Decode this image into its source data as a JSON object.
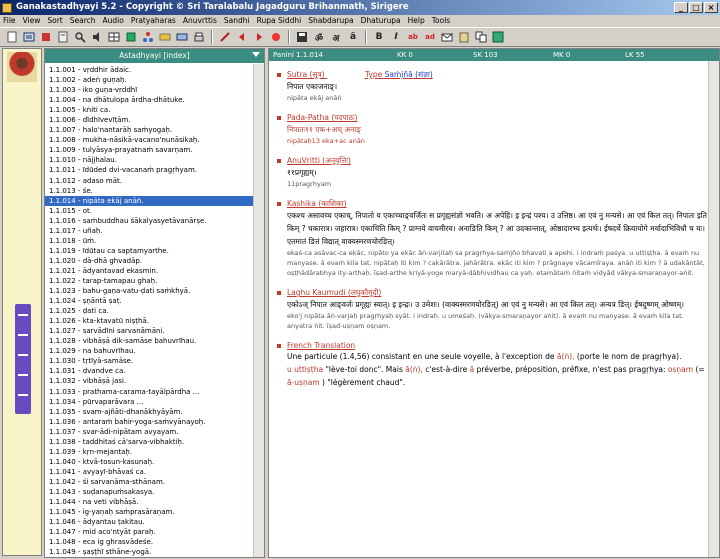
{
  "window": {
    "title": "Ganakastadhyayi 5.2 - Copyright © Sri Taralabalu Jagadguru Brihanmath, Sirigere",
    "buttons": [
      "_",
      "□",
      "×"
    ]
  },
  "menu": [
    "File",
    "View",
    "Sort",
    "Search",
    "Audio",
    "Pratyaharas",
    "Anuvrttis",
    "Sandhi",
    "Rupa Siddhi",
    "Shabdarupa",
    "Dhaturupa",
    "Help",
    "Tools"
  ],
  "toolbar": {
    "text_buttons": [
      "ॐ",
      "अ",
      "ä",
      "B",
      "I",
      "ab",
      "ad"
    ]
  },
  "vertical_title": "अष्टाध्यायी",
  "index": {
    "header": "Astadhyayi [index]",
    "items": [
      {
        "id": "1.1.001",
        "text": "vṛddhir ādaic."
      },
      {
        "id": "1.1.002",
        "text": "adeṅ guṇaḥ."
      },
      {
        "id": "1.1.003",
        "text": "iko guṇa-vṛddhī"
      },
      {
        "id": "1.1.004",
        "text": "na dhātulopa ārdha-dhātuke."
      },
      {
        "id": "1.1.005",
        "text": "kṅiti ca."
      },
      {
        "id": "1.1.006",
        "text": "dīdhīvevīṭām."
      },
      {
        "id": "1.1.007",
        "text": "halo'nantarāḥ saṁyogaḥ."
      },
      {
        "id": "1.1.008",
        "text": "mukha-nāsikā-vacano'nunāsikaḥ."
      },
      {
        "id": "1.1.009",
        "text": "tulyāsya-prayatnaṁ savarṇam."
      },
      {
        "id": "1.1.010",
        "text": "nājjhalau."
      },
      {
        "id": "1.1.011",
        "text": "īdūded dvi-vacanaṁ pragṛhyam."
      },
      {
        "id": "1.1.012",
        "text": "adaso māt."
      },
      {
        "id": "1.1.013",
        "text": "śe."
      },
      {
        "id": "1.1.014",
        "text": "nipāta ekāj anāṅ."
      },
      {
        "id": "1.1.015",
        "text": "ot."
      },
      {
        "id": "1.1.016",
        "text": "saṁbuddhau śākalyasyetāvanārṣe."
      },
      {
        "id": "1.1.017",
        "text": "uñaḥ."
      },
      {
        "id": "1.1.018",
        "text": "ūṁ."
      },
      {
        "id": "1.1.019",
        "text": "īdūtau ca saptamyarthe."
      },
      {
        "id": "1.1.020",
        "text": "dā-dhā ghvadāp."
      },
      {
        "id": "1.1.021",
        "text": "ādyantavad ekasmin."
      },
      {
        "id": "1.1.022",
        "text": "tarap-tamapau ghaḥ."
      },
      {
        "id": "1.1.023",
        "text": "bahu-gaṇa-vatu-ḍati saṁkhyā."
      },
      {
        "id": "1.1.024",
        "text": "ṣṇāntā ṣaṭ."
      },
      {
        "id": "1.1.025",
        "text": "ḍati ca."
      },
      {
        "id": "1.1.026",
        "text": "kta-ktavatū niṣṭhā."
      },
      {
        "id": "1.1.027",
        "text": "sarvādīni sarvanāmāni."
      },
      {
        "id": "1.1.028",
        "text": "vibhāṣā dik-samāse bahuvrīhau."
      },
      {
        "id": "1.1.029",
        "text": "na bahuvrīhau."
      },
      {
        "id": "1.1.030",
        "text": "tṛtīyā-samāse."
      },
      {
        "id": "1.1.031",
        "text": "dvandve ca."
      },
      {
        "id": "1.1.032",
        "text": "vibhāṣā jasi."
      },
      {
        "id": "1.1.033",
        "text": "prathama-carama-tayālpārdha ..."
      },
      {
        "id": "1.1.034",
        "text": "pūrvaparāvara ..."
      },
      {
        "id": "1.1.035",
        "text": "svam-ajñāti-dhanākhyāyām."
      },
      {
        "id": "1.1.036",
        "text": "antaraṁ bahir-yoga-saṁvyānayoḥ."
      },
      {
        "id": "1.1.037",
        "text": "svar-ādi-nipātam avyayam."
      },
      {
        "id": "1.1.038",
        "text": "taddhitaś cā'sarva-vibhaktiḥ."
      },
      {
        "id": "1.1.039",
        "text": "kṛn-mejantaḥ."
      },
      {
        "id": "1.1.040",
        "text": "ktvā-tosun-kasunaḥ."
      },
      {
        "id": "1.1.041",
        "text": "avyayī-bhāvaś ca."
      },
      {
        "id": "1.1.042",
        "text": "śi sarvanāma-sthānam."
      },
      {
        "id": "1.1.043",
        "text": "suḍanapuṁsakasya."
      },
      {
        "id": "1.1.044",
        "text": "na veti vibhāṣā."
      },
      {
        "id": "1.1.045",
        "text": "ig-yaṇaḥ saṁprasāraṇam."
      },
      {
        "id": "1.1.046",
        "text": "ādyantau ṭakitau."
      },
      {
        "id": "1.1.047",
        "text": "mid aco'ntyāt paraḥ."
      },
      {
        "id": "1.1.048",
        "text": "eca ig ghrasvādeśe."
      },
      {
        "id": "1.1.049",
        "text": "ṣaṣṭhī sthāne-yogā."
      }
    ]
  },
  "detail": {
    "header": {
      "sutra": "Panini 1.1.014",
      "kk": "KK 0",
      "sk": "SK 103",
      "mk": "MK 0",
      "lk": "LK 55"
    },
    "sutra": {
      "label": "Sutra",
      "label_dev": "(सूत्र)",
      "type_label": "Type",
      "type_value": "Saṁjñā",
      "type_dev": "(संज्ञा)",
      "dev": "निपात एकाजनाङ्।",
      "translit": "nipāta ekāj anāṅ"
    },
    "padapatha": {
      "label": "Pada-Patha",
      "label_dev": "(पदपाठः)",
      "dev": "निपातः११ एक+अच् अनाङ्",
      "translit": "nipātaḥ13 eka+ac anāṅ"
    },
    "anuvrtti": {
      "label": "AnuVritti",
      "label_dev": "(अनुवृत्तिः)",
      "dev": "११प्रगृह्यम्।",
      "translit": "11pragṛhyam"
    },
    "kashika": {
      "label": "Kashika",
      "label_dev": "(काशिका)",
      "dev": "एकश्च असावच्च एकाच्, निपातो य एकाच्चाङ्वर्जितः स प्रगृह्यसंज्ञो भवति। अ अपेहि। इ इन्द्रं पश्य। उ उत्तिष्ठ। आ एवं नु मन्यसे। आ एवं किल तत्। निपातः इति किम् ? चकारात्र। जहारात्र। एकाचिति किम् ? प्राग्नये वाचमीरय। अनाङिति किम् ? आ उदकान्तात्, ओष्ठादारभ्य इत्यर्थः। ईषदर्थे क्रियायोगे मर्यादाभिविधौ च यः। एतमातं ङितं विद्यात् वाक्यस्मरणयोरङित्।",
      "translit": "ekaś-ca asāvac-ca ekāc, nipāto ya ekāc āṅ-varjitaḥ sa pragṛhya-saṁjño bhavati a apehi. i indraṁ paśya. u uttiṣṭha. ā evaṁ nu manyase. ā evaṁ kila tat. nipātaḥ iti kim ? cakārātra. jahārātra. ekāc iti kim ? prāgnaye vācamīraya. anāṅ iti kim ? ā udakāntāt, oṣṭhādārabhya ity-arthaḥ. īṣad-arthe kriyā-yoge maryā-dābhividhau ca yaḥ. etamātaṁ ṅitaṁ vidyād vākya-smaraṇayor-aṅit."
    },
    "laghu": {
      "label": "Laghu Kaumudi",
      "label_dev": "(लघुकौमुदी)",
      "dev": "एकोऽज् निपात आङ्वर्जः प्रगृह्यः स्यात्। इ इन्द्रः। उ उमेशः। (वाक्यस्मरणयोरङित्) आ एवं नु मन्यसे। आ एवं किल तत्। अन्यत्र ङित्। ईषदुष्णम् ओष्णम्।",
      "translit": "eko'j nipāta āṅ-varjaḥ pragṛhyaḥ syāt. i indraḥ. u umeśaḥ. (vākya-smaraṇayor aṅit). ā evaṁ nu manyase. ā evaṁ kila tat. anyatra ṅit. īṣad-uṣṇam oṣṇam."
    },
    "french": {
      "label": "French Translation",
      "line1": "Une particule (1.4,56) consistant en une seule voyelle, à l'exception de",
      "line1_red": "ā(ṅ),",
      "line1_end": "(porte le nom de pragṛhya).",
      "line2_red1": "u uttiṣṭha",
      "line2_mid": "\"lève-toi donc\". Mais",
      "line2_red2": "ā(ṅ),",
      "line2_mid2": "c'est-à-dire",
      "line2_red3": "ā",
      "line2_mid3": "préverbe, préposition, préfixe, n'est pas pragṛhya:",
      "line2_red4": "osṇam",
      "line2_eq": "(=",
      "line2_red5": "ā-uṣṇam",
      "line2_end": ") \"légèrement chaud\"."
    }
  },
  "colors": {
    "panel_header": "#3a8d80",
    "selection": "#316ac5",
    "section_heading": "#c0392b",
    "titlebar": "#0a246a"
  }
}
